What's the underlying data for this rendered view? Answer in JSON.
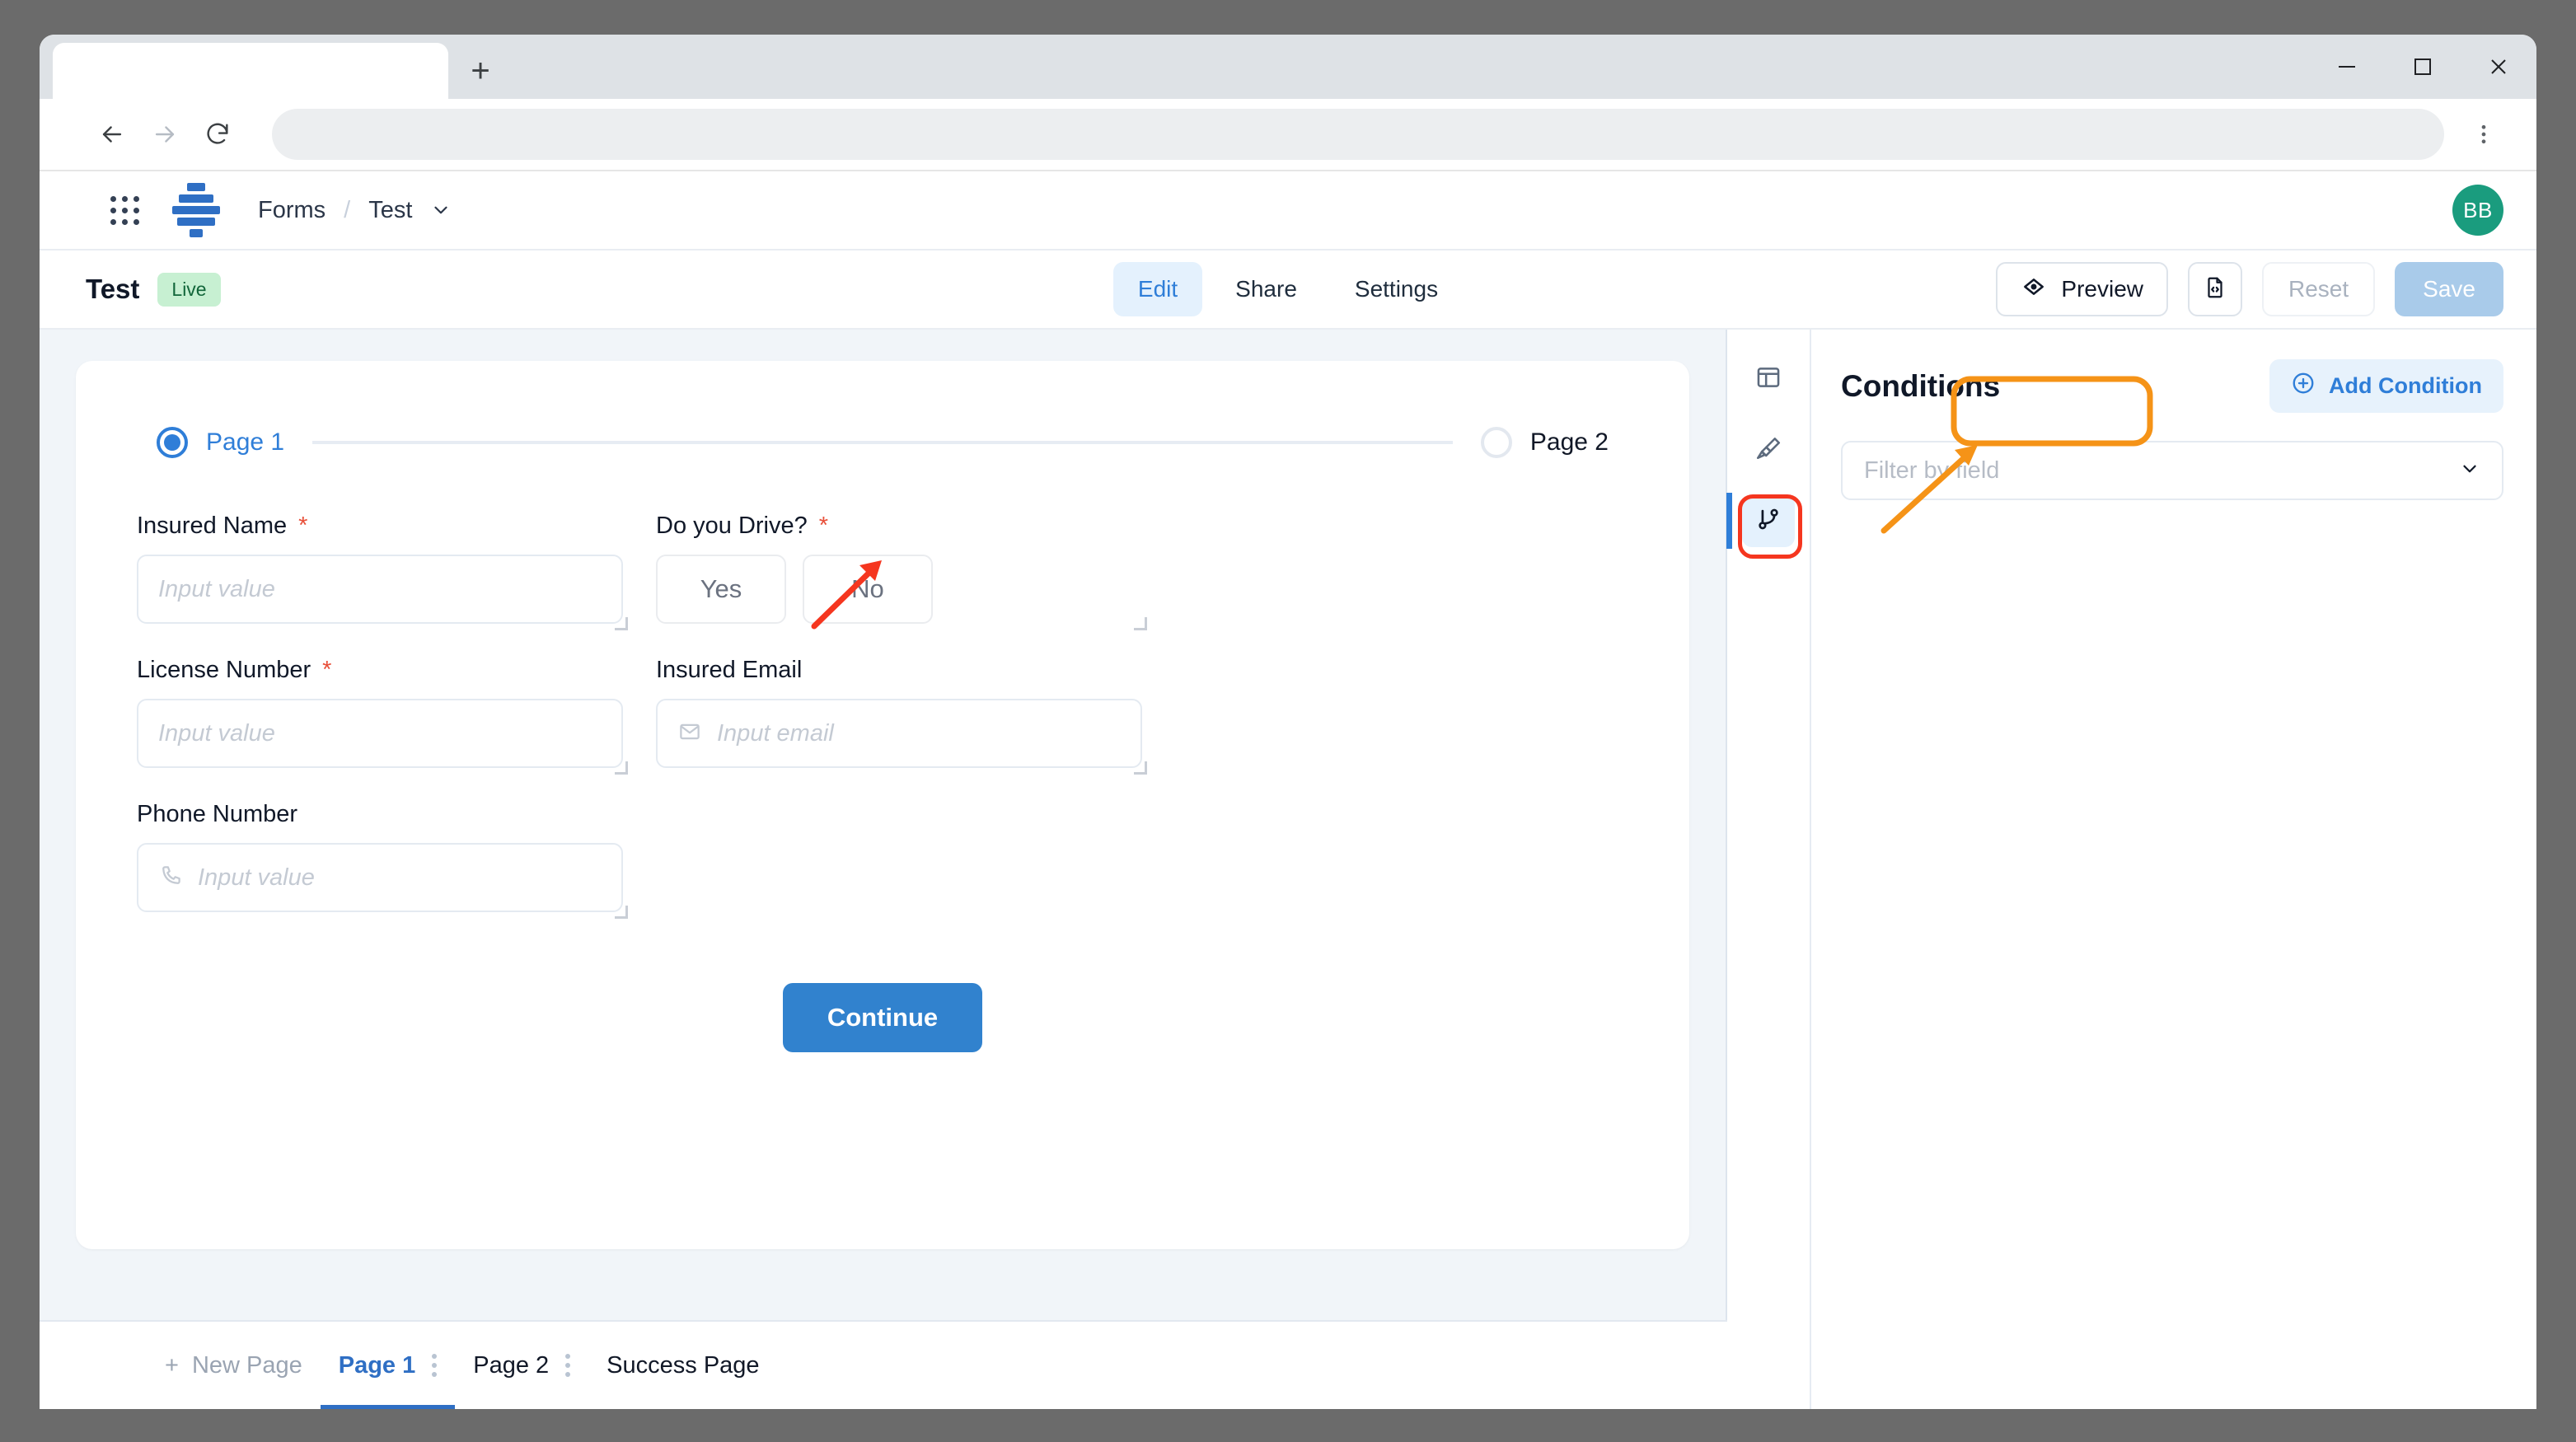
{
  "browser": {
    "tab_title": "",
    "url_value": "",
    "url_placeholder": "",
    "icons": {
      "new_tab": "plus-icon",
      "back": "back-arrow-icon",
      "forward": "forward-arrow-icon",
      "reload": "reload-icon",
      "menu": "kebab-menu-icon",
      "minimize": "minimize-icon",
      "maximize": "maximize-icon",
      "close": "close-icon"
    }
  },
  "appbar": {
    "apps_icon": "grid-apps-icon",
    "logo_icon": "forms-logo-icon",
    "breadcrumb": {
      "root": "Forms",
      "separator": "/",
      "current": "Test",
      "chevron": "chevron-down-icon"
    },
    "avatar_initials": "BB"
  },
  "toolbar": {
    "title": "Test",
    "status_badge": "Live",
    "tabs": [
      {
        "label": "Edit",
        "active": true
      },
      {
        "label": "Share",
        "active": false
      },
      {
        "label": "Settings",
        "active": false
      }
    ],
    "preview_label": "Preview",
    "preview_icon": "eye-hexagon-icon",
    "code_icon": "code-file-icon",
    "reset_label": "Reset",
    "save_label": "Save"
  },
  "form": {
    "steps": [
      {
        "label": "Page 1",
        "active": true
      },
      {
        "label": "Page 2",
        "active": false
      }
    ],
    "fields": [
      {
        "label": "Insured Name",
        "required": "*",
        "placeholder": "Input value",
        "icon": ""
      },
      {
        "label": "Do you Drive?",
        "required": "*",
        "options": [
          "Yes",
          "No"
        ]
      },
      {
        "label": "License Number",
        "required": "*",
        "placeholder": "Input value",
        "icon": ""
      },
      {
        "label": "Insured Email",
        "required": "",
        "placeholder": "Input email",
        "icon": "envelope-icon"
      },
      {
        "label": "Phone Number",
        "required": "",
        "placeholder": "Input value",
        "icon": "phone-icon"
      }
    ],
    "submit_label": "Continue"
  },
  "pagebar": {
    "new_page_label": "New Page",
    "new_page_icon": "plus-icon",
    "tabs": [
      {
        "label": "Page 1",
        "active": true,
        "has_menu": true
      },
      {
        "label": "Page 2",
        "active": false,
        "has_menu": true
      },
      {
        "label": "Success Page",
        "active": false,
        "has_menu": false
      }
    ]
  },
  "rail": {
    "items": [
      {
        "icon": "layout-panel-icon",
        "active": false
      },
      {
        "icon": "paintbrush-icon",
        "active": false
      },
      {
        "icon": "git-branch-icon",
        "active": true
      }
    ]
  },
  "panel": {
    "title": "Conditions",
    "add_button_label": "Add Condition",
    "add_button_icon": "plus-circle-icon",
    "filter_placeholder": "Filter by field",
    "filter_chevron": "chevron-down-icon"
  },
  "annotations": {
    "red_color": "#f5361f",
    "orange_color": "#f59317",
    "red_target": "git-branch-rail-button",
    "orange_target": "add-condition-button"
  },
  "colors": {
    "accent_blue": "#2f7ed8",
    "primary_button": "#3182ce",
    "avatar_green": "#1a9c7e",
    "live_badge_bg": "#c7f0d2",
    "canvas_bg": "#f1f5f9"
  }
}
